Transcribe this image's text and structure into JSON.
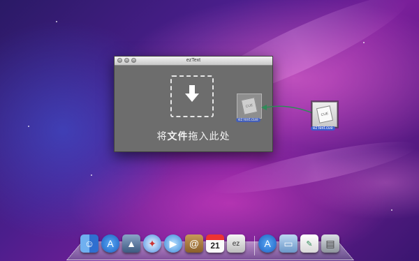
{
  "window": {
    "title": "ezText",
    "drop_label_prefix": "将",
    "drop_label_bold": "文件",
    "drop_label_suffix": "拖入此处"
  },
  "desktop": {
    "dragged_file_ghost_label": "ezText.cue",
    "file_icon_label": "ezText.cue",
    "file_icon_badge": "CUE"
  },
  "dock": {
    "items": [
      {
        "name": "finder",
        "icon": "finder-icon"
      },
      {
        "name": "app-store",
        "icon": "app-store-icon"
      },
      {
        "name": "preview",
        "icon": "preview-icon"
      },
      {
        "name": "safari",
        "icon": "safari-icon"
      },
      {
        "name": "facetime",
        "icon": "facetime-icon"
      },
      {
        "name": "address-book",
        "icon": "address-book-icon"
      },
      {
        "name": "calendar",
        "icon": "calendar-icon",
        "text": "21"
      },
      {
        "name": "eztext",
        "icon": "eztext-icon"
      },
      {
        "name": "app-store-2",
        "icon": "app-store-icon"
      },
      {
        "name": "documents",
        "icon": "folder-icon"
      },
      {
        "name": "textedit",
        "icon": "document-icon"
      },
      {
        "name": "trash",
        "icon": "trash-icon"
      }
    ]
  },
  "colors": {
    "window_bg": "#6d6d6d",
    "selection_blue": "#3a5ccc",
    "arrow_green": "#2e8b57"
  }
}
